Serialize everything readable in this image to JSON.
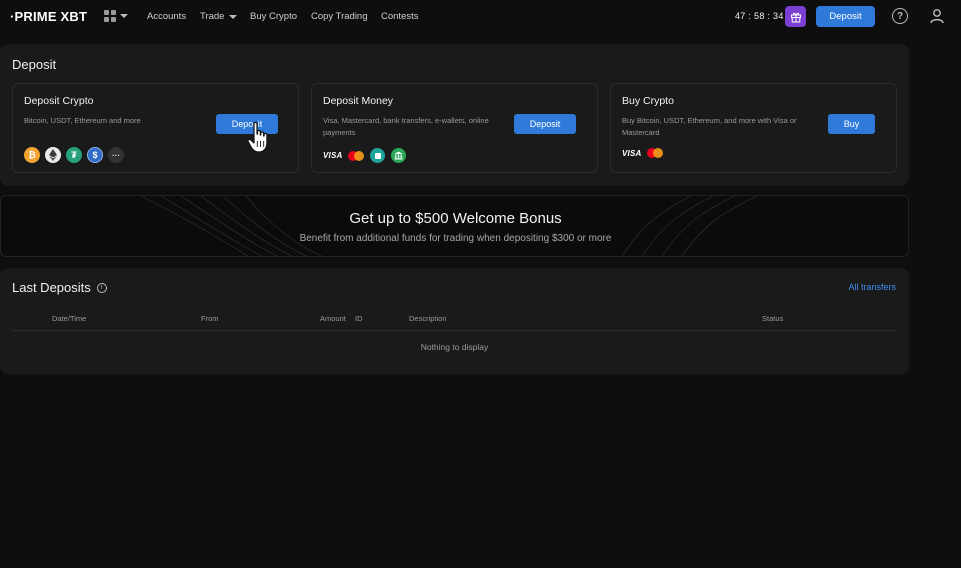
{
  "nav": {
    "logo": "·PRIME XBT",
    "items": [
      "Accounts",
      "Trade",
      "Buy Crypto",
      "Copy Trading",
      "Contests"
    ],
    "timer": "47 : 58 : 34",
    "deposit_label": "Deposit",
    "help_symbol": "?"
  },
  "deposit": {
    "title": "Deposit",
    "cards": [
      {
        "title": "Deposit Crypto",
        "desc": "Bitcoin, USDT, Ethereum and more",
        "button": "Deposit"
      },
      {
        "title": "Deposit Money",
        "desc": "Visa, Mastercard, bank transfers, e-wallets, online payments",
        "button": "Deposit"
      },
      {
        "title": "Buy Crypto",
        "desc": "Buy Bitcoin, USDT, Ethereum, and more with Visa or Mastercard",
        "button": "Buy"
      }
    ],
    "crypto_icons": [
      "bitcoin-icon",
      "ethereum-icon",
      "tether-icon",
      "usdc-icon",
      "more-icon"
    ],
    "more_symbol": "···",
    "visa_label": "VISA",
    "colors": {
      "accent": "#2f7ad8",
      "gift": "#7b3fd2",
      "link": "#3d8ff0"
    }
  },
  "banner": {
    "title": "Get up to $500 Welcome Bonus",
    "subtitle": "Benefit from additional funds for trading when depositing $300 or more"
  },
  "last_deposits": {
    "title": "Last Deposits",
    "info_symbol": "i",
    "link": "All transfers",
    "columns": [
      "Date/Time",
      "From",
      "Amount",
      "ID",
      "Description",
      "Status"
    ],
    "empty": "Nothing to display"
  }
}
